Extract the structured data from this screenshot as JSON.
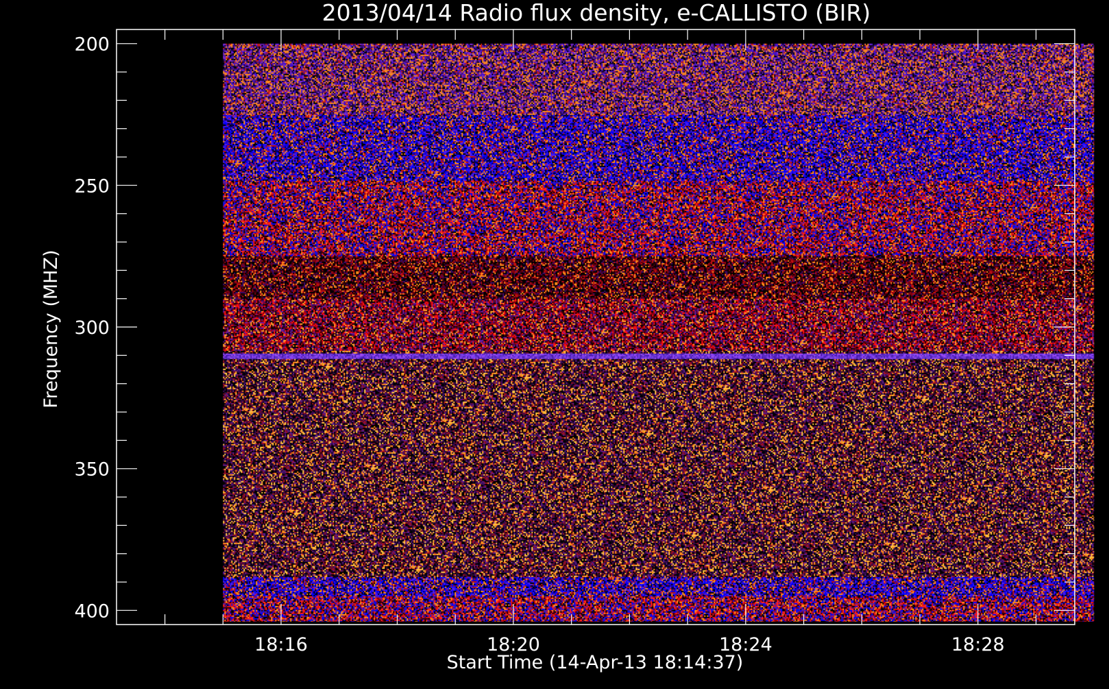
{
  "chart_data": {
    "type": "heatmap",
    "title": "2013/04/14  Radio flux density, e-CALLISTO (BIR)",
    "xlabel": "Start Time (14-Apr-13 18:14:37)",
    "ylabel": "Frequency (MHZ)",
    "x_axis": {
      "kind": "time",
      "start": "18:14:37",
      "end": "18:30:00",
      "major_ticks": [
        "18:16",
        "18:20",
        "18:24",
        "18:28"
      ],
      "minor_step_minutes": 1,
      "plot_range": [
        "18:13:10",
        "18:29:40"
      ]
    },
    "y_axis": {
      "kind": "frequency",
      "major_ticks": [
        200,
        250,
        300,
        350,
        400
      ],
      "minor_step": 10,
      "plot_range": [
        195,
        405
      ],
      "inverted": true
    },
    "data_extent": {
      "x": [
        "18:15:00",
        "18:30:00"
      ],
      "y": [
        200,
        404
      ]
    },
    "colors": {
      "background": "#000000",
      "axis": "#ffffff",
      "colormap": [
        "#000000",
        "#2a0a3a",
        "#4a0a6e",
        "#6a1a9a",
        "#2a0aff",
        "#0000ff",
        "#b00000",
        "#ff1010",
        "#ff8a1a",
        "#ffc040"
      ]
    },
    "bands": [
      {
        "freq_from": 200,
        "freq_to": 225,
        "tone": "purple"
      },
      {
        "freq_from": 225,
        "freq_to": 248,
        "tone": "blue"
      },
      {
        "freq_from": 248,
        "freq_to": 275,
        "tone": "red-blue"
      },
      {
        "freq_from": 275,
        "freq_to": 290,
        "tone": "dark-red"
      },
      {
        "freq_from": 290,
        "freq_to": 308,
        "tone": "red"
      },
      {
        "freq_from": 309,
        "freq_to": 311,
        "tone": "violet-line"
      },
      {
        "freq_from": 311,
        "freq_to": 388,
        "tone": "dark-purple"
      },
      {
        "freq_from": 388,
        "freq_to": 395,
        "tone": "blue"
      },
      {
        "freq_from": 395,
        "freq_to": 404,
        "tone": "red-blue"
      }
    ]
  }
}
